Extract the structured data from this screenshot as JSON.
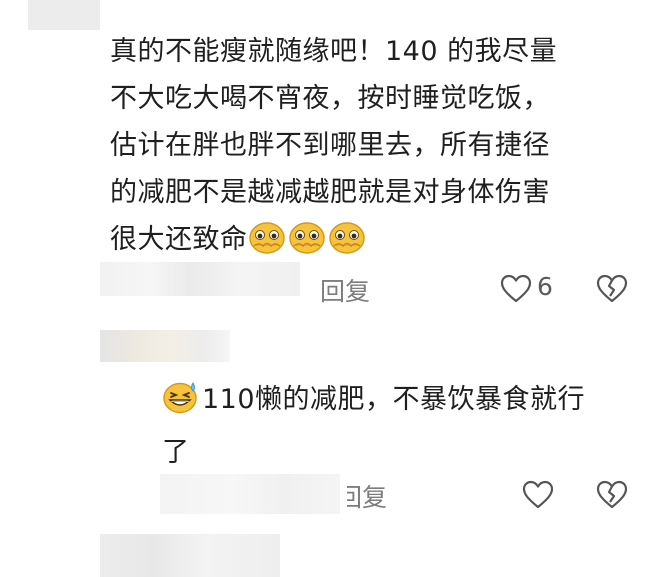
{
  "comment1": {
    "lines": [
      "真的不能瘦就随缘吧！140 的我尽量",
      "不大吃大喝不宵夜，按时睡觉吃饭，",
      "估计在胖也胖不到哪里去，所有捷径",
      "的减肥不是越减越肥就是对身体伤害",
      "很大还致命"
    ],
    "trailing_emojis": [
      "pleading-face-icon",
      "pleading-face-icon",
      "pleading-face-icon"
    ],
    "reply_label": "回复",
    "like_count": "6"
  },
  "reply1": {
    "leading_emoji": "grinning-sweat-face-icon",
    "lines": [
      "110懒的减肥，不暴饮暴食就行",
      "了"
    ],
    "reply_label": "回复"
  },
  "colors": {
    "text": "#1f1f1f",
    "muted": "#7d7d7d",
    "emoji_yellow": "#f6c43a"
  }
}
